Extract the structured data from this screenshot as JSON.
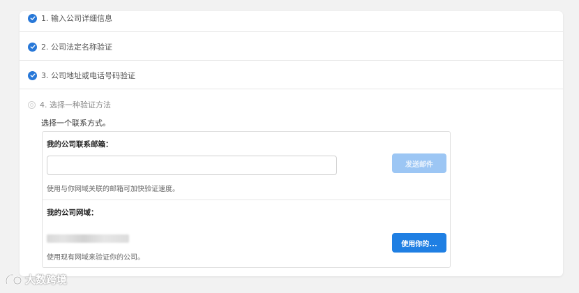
{
  "steps": [
    {
      "label": "1. 输入公司详细信息",
      "status": "complete"
    },
    {
      "label": "2. 公司法定名称验证",
      "status": "complete"
    },
    {
      "label": "3. 公司地址或电话号码验证",
      "status": "complete"
    },
    {
      "label": "4. 选择一种验证方法",
      "status": "current"
    }
  ],
  "verification": {
    "intro": "选择一个联系方式。",
    "email": {
      "label": "我的公司联系邮箱：",
      "value": "",
      "placeholder": "",
      "button_label": "发送邮件",
      "button_enabled": false,
      "help": "使用与你网域关联的邮箱可加快验证速度。"
    },
    "domain": {
      "label": "我的公司网域：",
      "button_label": "使用你的...",
      "help": "使用现有网域来验证你的公司。"
    }
  },
  "watermark": {
    "text": "大数跨境"
  },
  "colors": {
    "accent": "#1f7fe3",
    "check": "#2878d8",
    "disabled_button": "#9cc6f4",
    "page_background": "#f2f2f2"
  },
  "icons": {
    "complete": "checkmark-circle-icon",
    "current": "radio-circle-icon"
  }
}
